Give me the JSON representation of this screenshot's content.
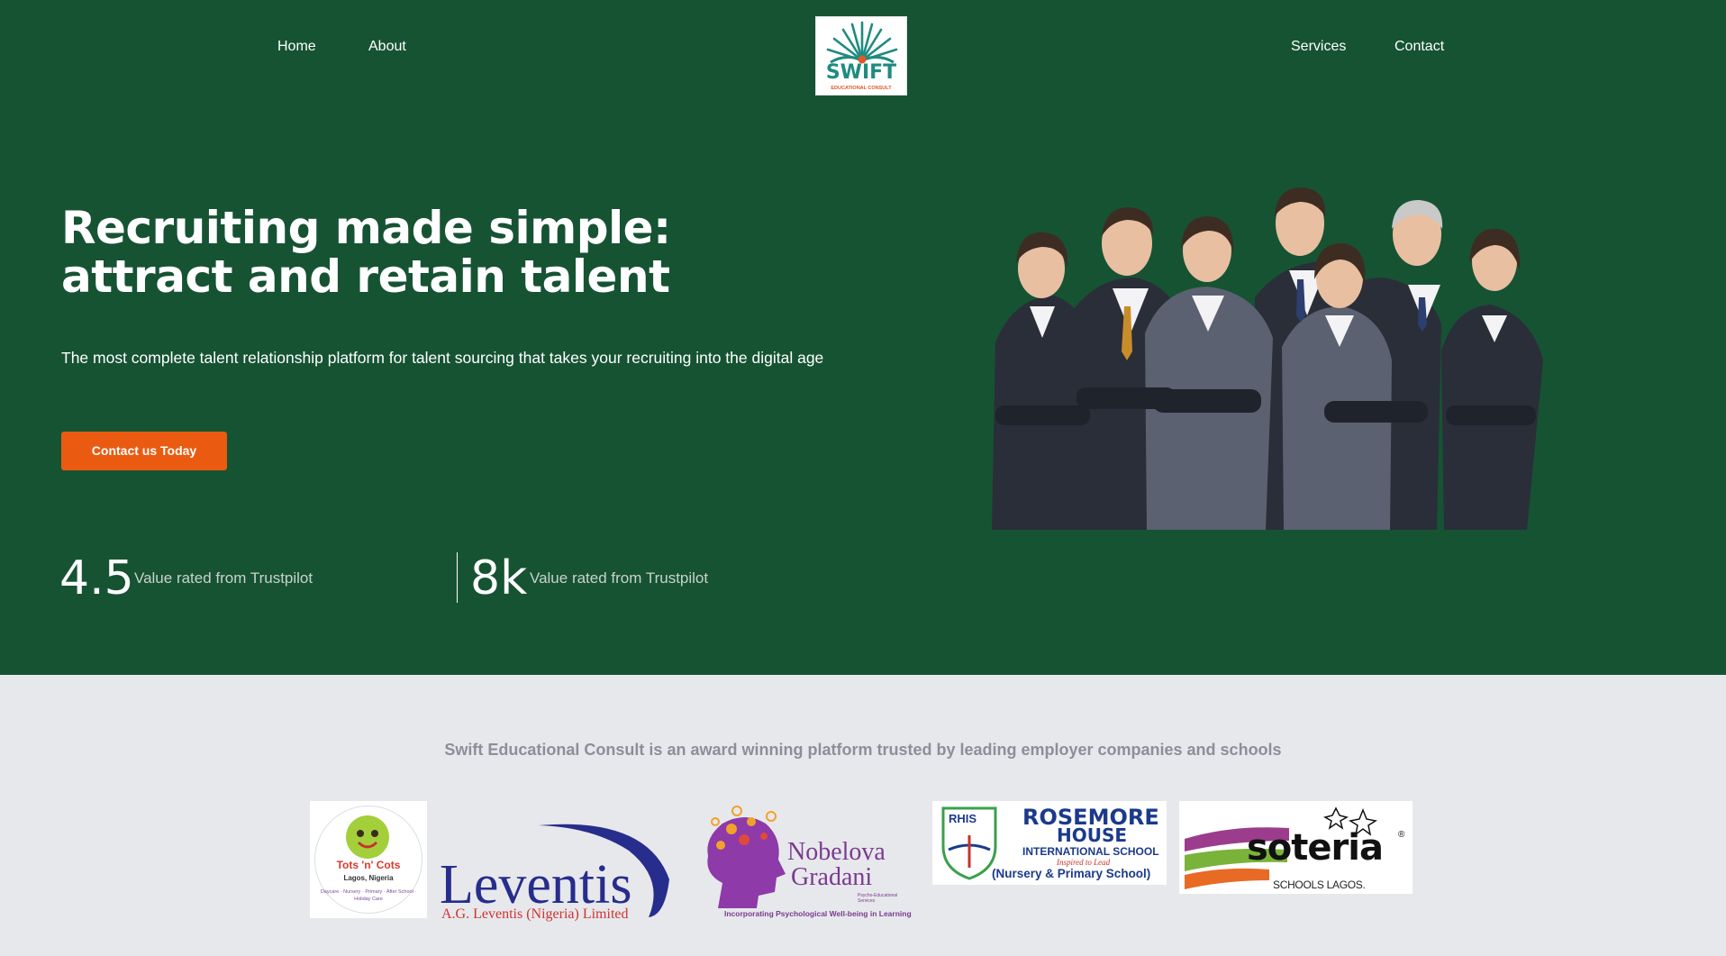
{
  "nav": {
    "home": "Home",
    "about": "About",
    "services": "Services",
    "contact": "Contact"
  },
  "logo": {
    "word": "SWIFT",
    "sub": "EDUCATIONAL CONSULT"
  },
  "hero": {
    "headline": "Recruiting made simple: attract and retain talent",
    "subtext": "The most complete talent relationship platform for talent sourcing that takes your recruiting into the digital age",
    "cta_label": "Contact us Today"
  },
  "stats": [
    {
      "value": "4.5",
      "label": "Value rated from Trustpilot"
    },
    {
      "value": "8k",
      "label": "Value rated from Trustpilot"
    }
  ],
  "trust": {
    "text": "Swift Educational Consult is an award winning platform trusted by leading employer companies and schools"
  },
  "partners": {
    "tots": {
      "name": "Tots 'n' Cots",
      "city": "Lagos, Nigeria",
      "tagline": "Daycare · Nursery · Primary · After School · Holiday Care"
    },
    "leventis": {
      "word": "Leventis",
      "ltd": "A.G. Leventis (Nigeria) Limited"
    },
    "nobelova": {
      "line1": "Nobelova",
      "line2": "Gradani",
      "small": "Psycho-Educational Services",
      "tagline": "Incorporating Psychological Well-being in Learning"
    },
    "rosemore": {
      "abbr": "RHIS",
      "line1": "ROSEMORE",
      "line2": "HOUSE",
      "line3": "INTERNATIONAL SCHOOL",
      "motto": "Inspired to Lead",
      "line4": "(Nursery & Primary School)"
    },
    "soteria": {
      "word": "soteria",
      "reg": "®",
      "sub": "SCHOOLS LAGOS."
    }
  },
  "colors": {
    "hero_bg": "#165333",
    "cta_bg": "#ea5b11",
    "page_bg": "#e7e8ec"
  }
}
